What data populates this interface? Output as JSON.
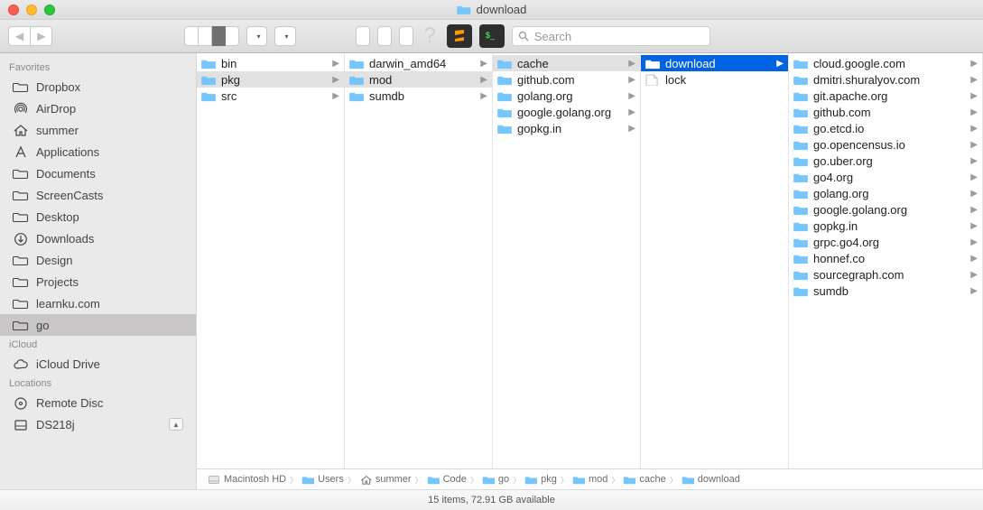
{
  "window": {
    "title": "download"
  },
  "toolbar": {
    "search_placeholder": "Search"
  },
  "sidebar": {
    "sections": [
      {
        "label": "Favorites",
        "items": [
          {
            "icon": "folder",
            "label": "Dropbox"
          },
          {
            "icon": "airdrop",
            "label": "AirDrop"
          },
          {
            "icon": "home",
            "label": "summer"
          },
          {
            "icon": "apps",
            "label": "Applications"
          },
          {
            "icon": "folder",
            "label": "Documents"
          },
          {
            "icon": "folder",
            "label": "ScreenCasts"
          },
          {
            "icon": "folder",
            "label": "Desktop"
          },
          {
            "icon": "download",
            "label": "Downloads"
          },
          {
            "icon": "folder",
            "label": "Design"
          },
          {
            "icon": "folder",
            "label": "Projects"
          },
          {
            "icon": "folder",
            "label": "learnku.com"
          },
          {
            "icon": "folder",
            "label": "go",
            "active": true
          }
        ]
      },
      {
        "label": "iCloud",
        "items": [
          {
            "icon": "cloud",
            "label": "iCloud Drive"
          }
        ]
      },
      {
        "label": "Locations",
        "items": [
          {
            "icon": "disc",
            "label": "Remote Disc"
          },
          {
            "icon": "nas",
            "label": "DS218j",
            "eject": true
          }
        ]
      }
    ]
  },
  "columns": [
    {
      "items": [
        {
          "type": "folder",
          "name": "bin",
          "hasChildren": true
        },
        {
          "type": "folder",
          "name": "pkg",
          "hasChildren": true,
          "selected": "gray"
        },
        {
          "type": "folder",
          "name": "src",
          "hasChildren": true
        }
      ]
    },
    {
      "items": [
        {
          "type": "folder",
          "name": "darwin_amd64",
          "hasChildren": true
        },
        {
          "type": "folder",
          "name": "mod",
          "hasChildren": true,
          "selected": "gray"
        },
        {
          "type": "folder",
          "name": "sumdb",
          "hasChildren": true
        }
      ]
    },
    {
      "items": [
        {
          "type": "folder",
          "name": "cache",
          "hasChildren": true,
          "selected": "gray"
        },
        {
          "type": "folder",
          "name": "github.com",
          "hasChildren": true
        },
        {
          "type": "folder",
          "name": "golang.org",
          "hasChildren": true
        },
        {
          "type": "folder",
          "name": "google.golang.org",
          "hasChildren": true
        },
        {
          "type": "folder",
          "name": "gopkg.in",
          "hasChildren": true
        }
      ]
    },
    {
      "items": [
        {
          "type": "folder",
          "name": "download",
          "hasChildren": true,
          "selected": "blue"
        },
        {
          "type": "file",
          "name": "lock"
        }
      ]
    },
    {
      "items": [
        {
          "type": "folder",
          "name": "cloud.google.com",
          "hasChildren": true
        },
        {
          "type": "folder",
          "name": "dmitri.shuralyov.com",
          "hasChildren": true
        },
        {
          "type": "folder",
          "name": "git.apache.org",
          "hasChildren": true
        },
        {
          "type": "folder",
          "name": "github.com",
          "hasChildren": true
        },
        {
          "type": "folder",
          "name": "go.etcd.io",
          "hasChildren": true
        },
        {
          "type": "folder",
          "name": "go.opencensus.io",
          "hasChildren": true
        },
        {
          "type": "folder",
          "name": "go.uber.org",
          "hasChildren": true
        },
        {
          "type": "folder",
          "name": "go4.org",
          "hasChildren": true
        },
        {
          "type": "folder",
          "name": "golang.org",
          "hasChildren": true
        },
        {
          "type": "folder",
          "name": "google.golang.org",
          "hasChildren": true
        },
        {
          "type": "folder",
          "name": "gopkg.in",
          "hasChildren": true
        },
        {
          "type": "folder",
          "name": "grpc.go4.org",
          "hasChildren": true
        },
        {
          "type": "folder",
          "name": "honnef.co",
          "hasChildren": true
        },
        {
          "type": "folder",
          "name": "sourcegraph.com",
          "hasChildren": true
        },
        {
          "type": "folder",
          "name": "sumdb",
          "hasChildren": true
        }
      ]
    }
  ],
  "pathbar": [
    {
      "icon": "hd",
      "label": "Macintosh HD"
    },
    {
      "icon": "folder",
      "label": "Users"
    },
    {
      "icon": "home",
      "label": "summer"
    },
    {
      "icon": "folder",
      "label": "Code"
    },
    {
      "icon": "folder",
      "label": "go"
    },
    {
      "icon": "folder",
      "label": "pkg"
    },
    {
      "icon": "folder",
      "label": "mod"
    },
    {
      "icon": "folder",
      "label": "cache"
    },
    {
      "icon": "folder",
      "label": "download"
    }
  ],
  "statusbar": "15 items, 72.91 GB available"
}
